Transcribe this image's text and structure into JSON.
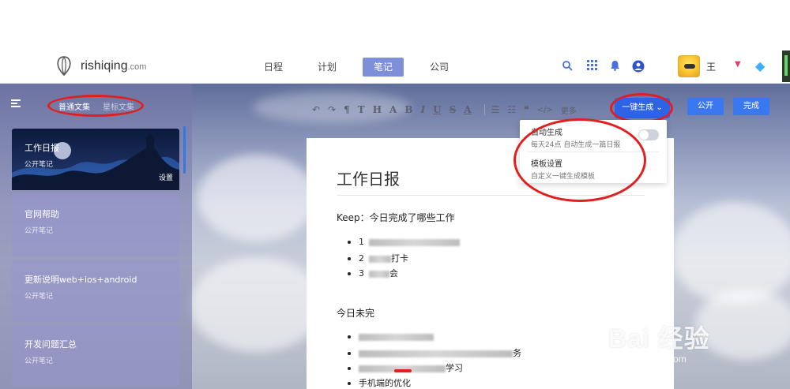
{
  "header": {
    "logo_text": "rishiqing",
    "logo_suffix": ".com",
    "nav": [
      {
        "label": "日程"
      },
      {
        "label": "计划"
      },
      {
        "label": "笔记"
      },
      {
        "label": "公司"
      }
    ],
    "username": "王"
  },
  "sidebar": {
    "tab_plain": "普通文集",
    "tab_star": "星标文集",
    "notes": [
      {
        "title": "工作日报",
        "subtitle": "公开笔记",
        "action": "设置"
      },
      {
        "title": "官网帮助",
        "subtitle": "公开笔记"
      },
      {
        "title": "更新说明web+ios+android",
        "subtitle": "公开笔记"
      },
      {
        "title": "开发问题汇总",
        "subtitle": "公开笔记"
      }
    ]
  },
  "toolbar": {
    "more_label": "更多",
    "generate_label": "一键生成",
    "publish_label": "公开",
    "done_label": "完成"
  },
  "dropdown": {
    "items": [
      {
        "title": "自动生成",
        "desc": "每天24点 自动生成一篇日报"
      },
      {
        "title": "模板设置",
        "desc": "自定义一键生成模板"
      }
    ]
  },
  "editor": {
    "title": "工作日报",
    "section1": "Keep：今日完成了哪些工作",
    "list1": [
      {
        "num": "1"
      },
      {
        "num": "2",
        "text": "打卡"
      },
      {
        "num": "3",
        "text": "会"
      }
    ],
    "section2": "今日未完",
    "list2": [
      {
        "text": ""
      },
      {
        "text": "务"
      },
      {
        "text": "学习"
      },
      {
        "text": "手机端的优化"
      }
    ]
  },
  "watermark": {
    "main": "Bai 经验",
    "sub": "jingyan.baidu.com"
  },
  "colors": {
    "accent": "#2f63e6",
    "nav_active": "#7d8fd8",
    "annotation": "#e02020"
  }
}
